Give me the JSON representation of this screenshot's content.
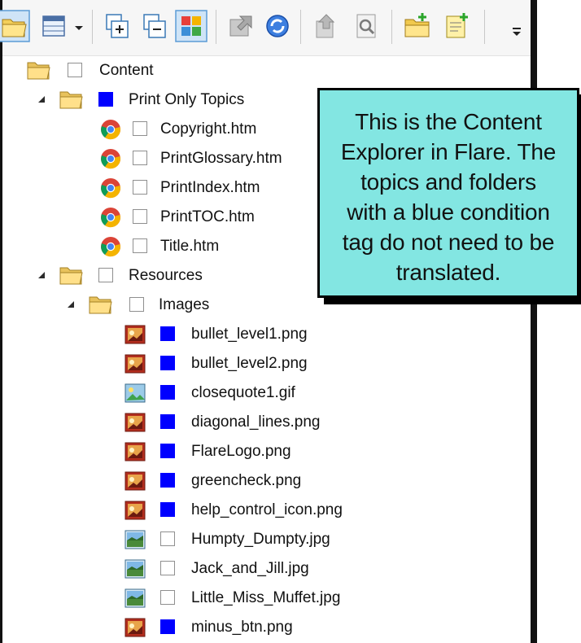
{
  "toolbar": {
    "buttons": [
      "open-folder-icon",
      "layout-icon",
      "dropdown-arrow-icon",
      "expand-all-icon",
      "collapse-all-icon",
      "show-files-icon",
      "export-icon",
      "refresh-icon",
      "upload-icon",
      "search-icon",
      "new-folder-icon",
      "new-topic-icon",
      "overflow-icon"
    ]
  },
  "tree": {
    "items": [
      {
        "label": "Content",
        "type": "folder",
        "tag": "none"
      },
      {
        "label": "Print Only Topics",
        "type": "folder",
        "tag": "blue"
      },
      {
        "label": "Copyright.htm",
        "type": "topic",
        "tag": "none"
      },
      {
        "label": "PrintGlossary.htm",
        "type": "topic",
        "tag": "none"
      },
      {
        "label": "PrintIndex.htm",
        "type": "topic",
        "tag": "none"
      },
      {
        "label": "PrintTOC.htm",
        "type": "topic",
        "tag": "none"
      },
      {
        "label": "Title.htm",
        "type": "topic",
        "tag": "none"
      },
      {
        "label": "Resources",
        "type": "folder",
        "tag": "none"
      },
      {
        "label": "Images",
        "type": "folder",
        "tag": "none"
      },
      {
        "label": "bullet_level1.png",
        "type": "png",
        "tag": "blue"
      },
      {
        "label": "bullet_level2.png",
        "type": "png",
        "tag": "blue"
      },
      {
        "label": "closequote1.gif",
        "type": "gif",
        "tag": "blue"
      },
      {
        "label": "diagonal_lines.png",
        "type": "png",
        "tag": "blue"
      },
      {
        "label": "FlareLogo.png",
        "type": "png",
        "tag": "blue"
      },
      {
        "label": "greencheck.png",
        "type": "png",
        "tag": "blue"
      },
      {
        "label": "help_control_icon.png",
        "type": "png",
        "tag": "blue"
      },
      {
        "label": "Humpty_Dumpty.jpg",
        "type": "jpg",
        "tag": "none"
      },
      {
        "label": "Jack_and_Jill.jpg",
        "type": "jpg",
        "tag": "none"
      },
      {
        "label": "Little_Miss_Muffet.jpg",
        "type": "jpg",
        "tag": "none"
      },
      {
        "label": "minus_btn.png",
        "type": "png",
        "tag": "blue"
      }
    ]
  },
  "callout": {
    "lines": [
      "This is the Content",
      "Explorer in Flare. The",
      "topics and folders",
      "with a blue condition",
      "tag do not need to be",
      "translated."
    ]
  },
  "colors": {
    "condition_tag": "#0000ff",
    "callout_bg": "#83e6e2",
    "toolbar_bg": "#f6f6f6"
  }
}
